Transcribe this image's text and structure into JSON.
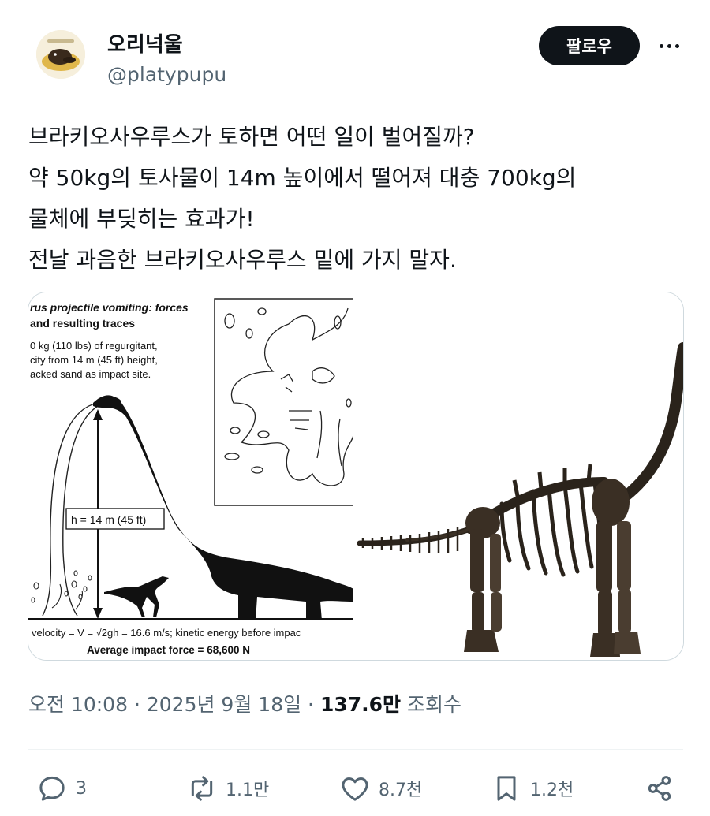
{
  "user": {
    "display_name": "오리넉울",
    "handle": "@platypupu",
    "follow_label": "팔로우"
  },
  "tweet": {
    "lines": [
      "브라키오사우루스가 토하면 어떤 일이 벌어질까?",
      "약 50kg의 토사물이 14m 높이에서 떨어져 대충 700kg의",
      "물체에 부딪히는 효과가!",
      "전날 과음한 브라키오사우루스 밑에 가지 말자."
    ]
  },
  "figure": {
    "title_line1": "rus projectile vomiting: forces",
    "title_line2": "and resulting traces",
    "desc_line1": "0 kg (110 lbs) of regurgitant,",
    "desc_line2": "city from 14 m (45 ft) height,",
    "desc_line3": "acked sand as impact site.",
    "height_label": "h = 14 m (45 ft)",
    "velocity_line": "velocity = V = √2gh = 16.6 m/s; kinetic energy before impac",
    "force_line": "Average impact force = 68,600 N"
  },
  "meta": {
    "time": "오전 10:08",
    "date": "2025년 9월 18일",
    "views_count": "137.6만",
    "views_label": "조회수"
  },
  "actions": {
    "replies": "3",
    "reposts": "1.1만",
    "likes": "8.7천",
    "bookmarks": "1.2천"
  }
}
